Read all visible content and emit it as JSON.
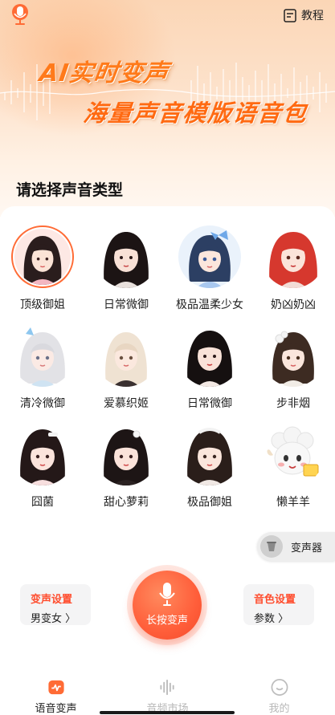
{
  "header": {
    "tutorial_label": "教程"
  },
  "hero": {
    "title": "AI实时变声",
    "subtitle": "海量声音模版语音包"
  },
  "section": {
    "title": "请选择声音类型"
  },
  "voices": [
    {
      "name": "顶级御姐",
      "selected": true
    },
    {
      "name": "日常微御"
    },
    {
      "name": "极品温柔少女"
    },
    {
      "name": "奶凶奶凶"
    },
    {
      "name": "清冷微御"
    },
    {
      "name": "爱慕织姬"
    },
    {
      "name": "日常微御"
    },
    {
      "name": "步非烟"
    },
    {
      "name": "囧菌"
    },
    {
      "name": "甜心萝莉"
    },
    {
      "name": "极品御姐"
    },
    {
      "name": "懒羊羊"
    }
  ],
  "changer": {
    "label": "变声器"
  },
  "controls": {
    "voice_setting_title": "变声设置",
    "voice_setting_value": "男变女 〉",
    "record_label": "长按变声",
    "timbre_setting_title": "音色设置",
    "timbre_setting_value": "参数 〉"
  },
  "nav": {
    "items": [
      {
        "label": "语音变声",
        "active": true
      },
      {
        "label": "音频市场"
      },
      {
        "label": "我的"
      }
    ]
  },
  "colors": {
    "accent": "#ff5e3a",
    "accent_text": "#ff4d2e",
    "hero_bg": "#fde3cd"
  }
}
